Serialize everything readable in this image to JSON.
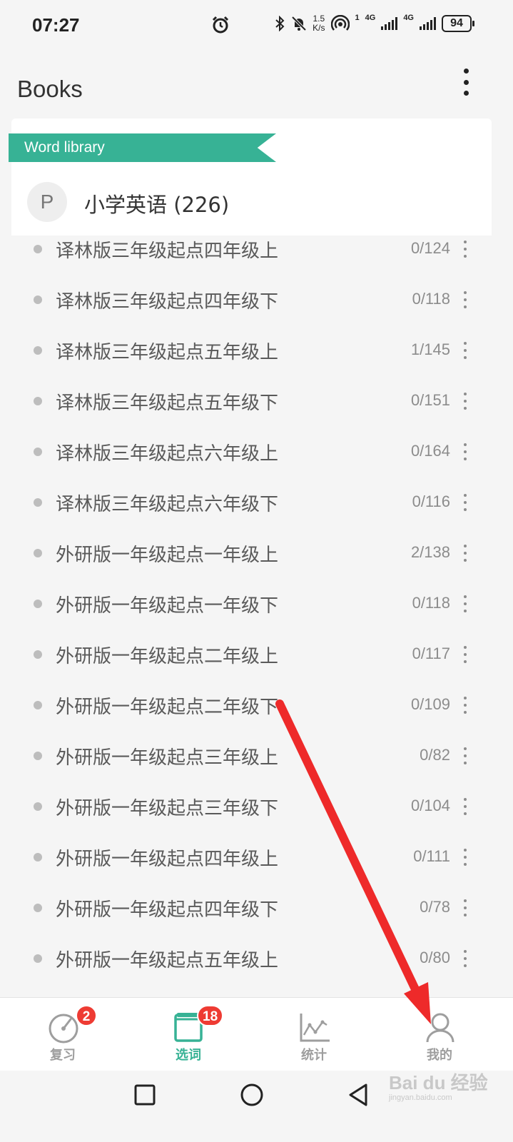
{
  "status_bar": {
    "time": "07:27",
    "net_speed_value": "1.5",
    "net_speed_unit": "K/s",
    "signal_1_label": "4G",
    "signal_2_label": "4G",
    "hotspot_label": "1",
    "battery": "94",
    "icons": [
      "alarm-icon",
      "bluetooth-icon",
      "bell-off-icon",
      "hotspot-icon",
      "signal-icon",
      "battery-icon"
    ]
  },
  "header": {
    "title": "Books"
  },
  "library": {
    "ribbon_label": "Word library",
    "avatar_letter": "P",
    "name": "小学英语 (226)"
  },
  "books": [
    {
      "name": "译林版三年级起点四年级上",
      "progress": "0/124"
    },
    {
      "name": "译林版三年级起点四年级下",
      "progress": "0/118"
    },
    {
      "name": "译林版三年级起点五年级上",
      "progress": "1/145"
    },
    {
      "name": "译林版三年级起点五年级下",
      "progress": "0/151"
    },
    {
      "name": "译林版三年级起点六年级上",
      "progress": "0/164"
    },
    {
      "name": "译林版三年级起点六年级下",
      "progress": "0/116"
    },
    {
      "name": "外研版一年级起点一年级上",
      "progress": "2/138"
    },
    {
      "name": "外研版一年级起点一年级下",
      "progress": "0/118"
    },
    {
      "name": "外研版一年级起点二年级上",
      "progress": "0/117"
    },
    {
      "name": "外研版一年级起点二年级下",
      "progress": "0/109"
    },
    {
      "name": "外研版一年级起点三年级上",
      "progress": "0/82"
    },
    {
      "name": "外研版一年级起点三年级下",
      "progress": "0/104"
    },
    {
      "name": "外研版一年级起点四年级上",
      "progress": "0/111"
    },
    {
      "name": "外研版一年级起点四年级下",
      "progress": "0/78"
    },
    {
      "name": "外研版一年级起点五年级上",
      "progress": "0/80"
    }
  ],
  "bottom_nav": {
    "tabs": [
      {
        "label": "复习",
        "badge": "2",
        "icon": "gauge-icon",
        "active": false
      },
      {
        "label": "选词",
        "badge": "18",
        "icon": "book-icon",
        "active": true
      },
      {
        "label": "统计",
        "badge": "",
        "icon": "chart-icon",
        "active": false
      },
      {
        "label": "我的",
        "badge": "",
        "icon": "person-icon",
        "active": false
      }
    ]
  },
  "watermark": {
    "text": "Bai du 经验",
    "sub": "jingyan.baidu.com"
  },
  "colors": {
    "accent": "#37b295",
    "badge": "#ee3b33",
    "annotation_arrow": "#ee2a2a"
  }
}
